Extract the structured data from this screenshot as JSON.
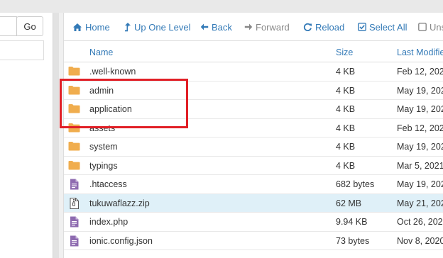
{
  "left_pane": {
    "go_label": "Go"
  },
  "toolbar": {
    "home": "Home",
    "up_one_level": "Up One Level",
    "back": "Back",
    "forward": "Forward",
    "reload": "Reload",
    "select_all": "Select All",
    "unselect_partial": "Uns"
  },
  "table": {
    "headers": {
      "name": "Name",
      "size": "Size",
      "last_modified": "Last Modifie"
    },
    "rows": [
      {
        "type": "folder",
        "name": ".well-known",
        "size": "4 KB",
        "date": "Feb 12, 202"
      },
      {
        "type": "folder",
        "name": "admin",
        "size": "4 KB",
        "date": "May 19, 202"
      },
      {
        "type": "folder",
        "name": "application",
        "size": "4 KB",
        "date": "May 19, 202"
      },
      {
        "type": "folder",
        "name": "assets",
        "size": "4 KB",
        "date": "Feb 12, 202"
      },
      {
        "type": "folder",
        "name": "system",
        "size": "4 KB",
        "date": "May 19, 202"
      },
      {
        "type": "folder",
        "name": "typings",
        "size": "4 KB",
        "date": "Mar 5, 2021"
      },
      {
        "type": "file",
        "name": ".htaccess",
        "size": "682 bytes",
        "date": "May 19, 202"
      },
      {
        "type": "zip",
        "name": "tukuwaflazz.zip",
        "size": "62 MB",
        "date": "May 21, 202",
        "selected": true
      },
      {
        "type": "file",
        "name": "index.php",
        "size": "9.94 KB",
        "date": "Oct 26, 202"
      },
      {
        "type": "file",
        "name": "ionic.config.json",
        "size": "73 bytes",
        "date": "Nov 8, 2020"
      }
    ]
  },
  "colors": {
    "link": "#337ab7",
    "folder": "#f0ad4e",
    "file": "#8e6bb0",
    "selected_row": "#dff0f8",
    "highlight_box": "#e11f26"
  },
  "icons": {
    "folder": "folder-icon",
    "file": "file-icon",
    "zip": "zip-file-icon"
  }
}
